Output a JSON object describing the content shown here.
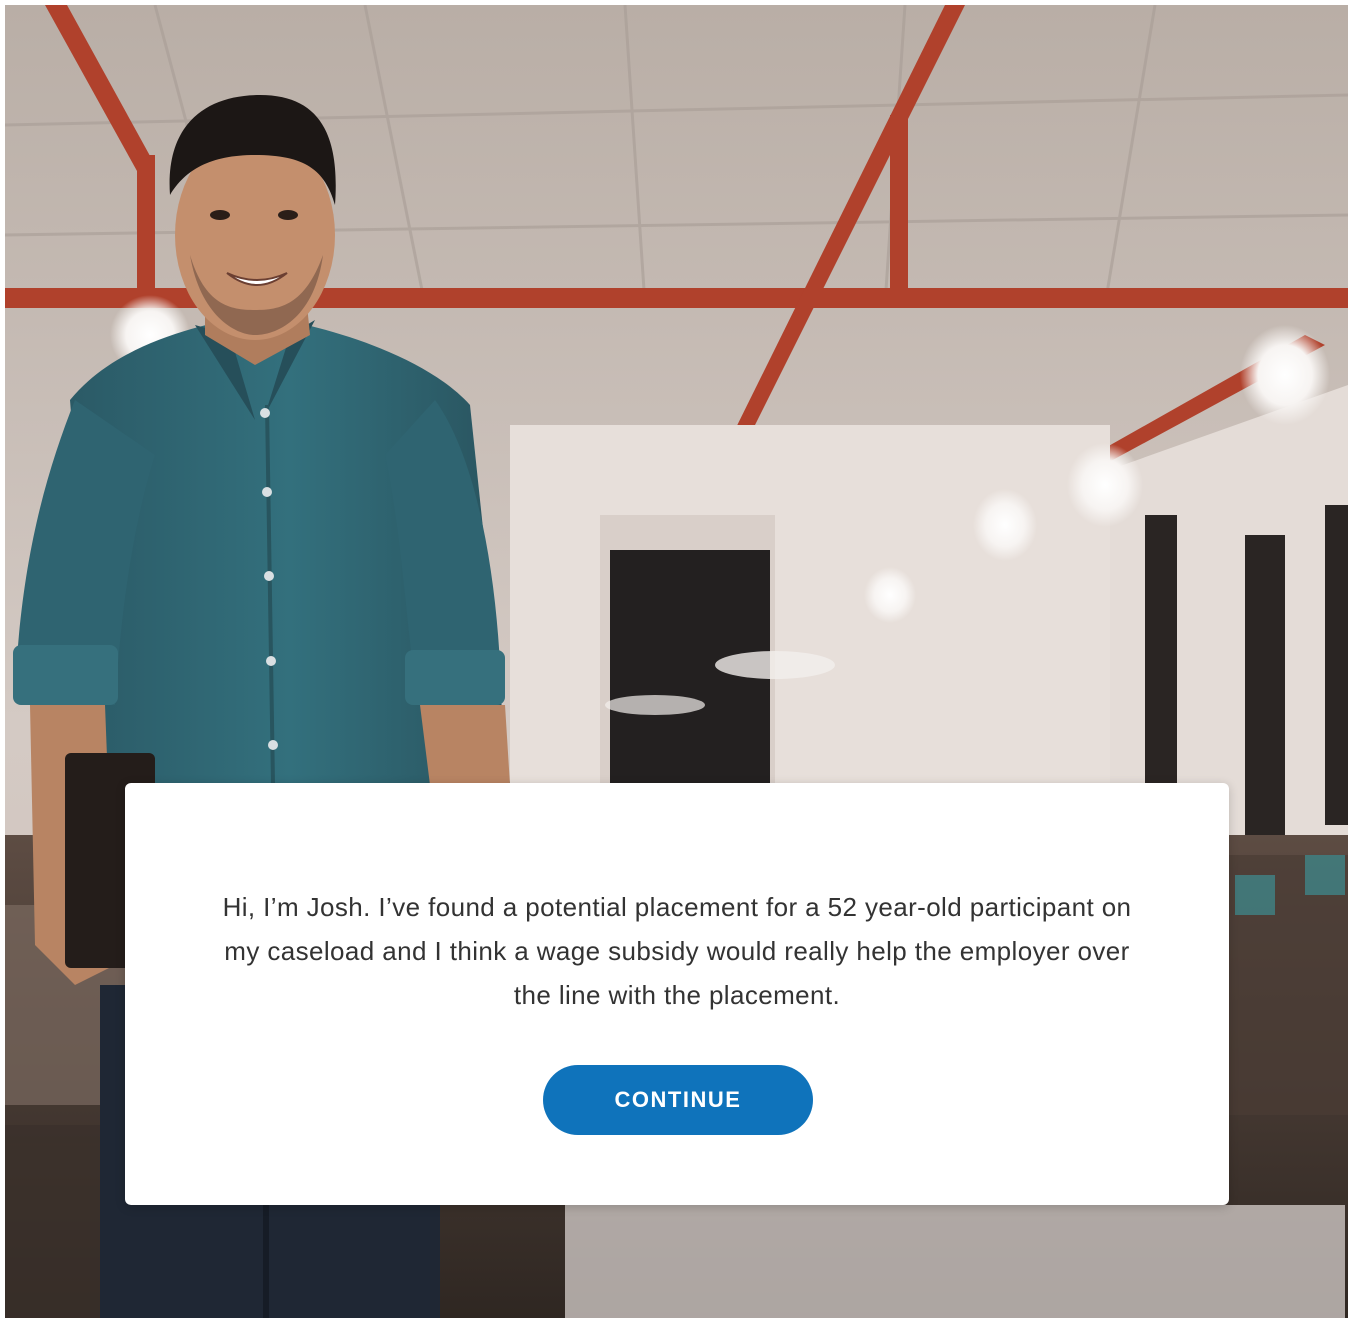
{
  "dialog": {
    "message": "Hi, I’m Josh. I’ve found a potential placement for a 52 year-old participant on my caseload and I think a wage subsidy would really help the employer over the line with the placement.",
    "continue_label": "CONTINUE"
  },
  "colors": {
    "button_bg": "#0f73bb",
    "button_text": "#ffffff",
    "dialog_bg": "#ffffff",
    "message_text": "#333333",
    "beam": "#b0412c",
    "shirt": "#2f6470"
  }
}
